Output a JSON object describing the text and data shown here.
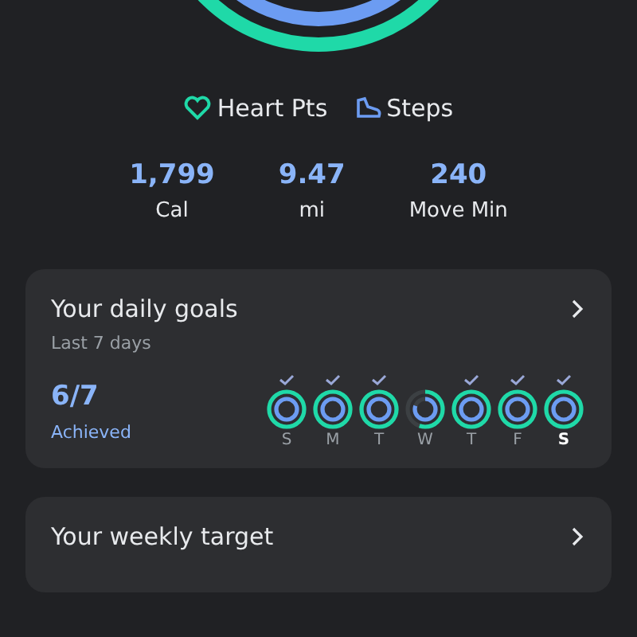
{
  "legend": [
    {
      "kind": "heart",
      "label": "Heart Pts"
    },
    {
      "kind": "steps",
      "label": "Steps"
    }
  ],
  "stats": [
    {
      "value": "1,799",
      "label": "Cal"
    },
    {
      "value": "9.47",
      "label": "mi"
    },
    {
      "value": "240",
      "label": "Move Min"
    }
  ],
  "daily_goals": {
    "title": "Your daily goals",
    "subtitle": "Last 7 days",
    "achieved": "6/7",
    "achieved_label": "Achieved",
    "days": [
      {
        "label": "S",
        "checked": true,
        "rings": [
          {
            "kind": "heart",
            "level": 1
          },
          {
            "kind": "steps",
            "level": 1
          }
        ],
        "today": false
      },
      {
        "label": "M",
        "checked": true,
        "rings": [
          {
            "kind": "heart",
            "level": 1
          },
          {
            "kind": "steps",
            "level": 1
          }
        ],
        "today": false
      },
      {
        "label": "T",
        "checked": true,
        "rings": [
          {
            "kind": "heart",
            "level": 1
          },
          {
            "kind": "steps",
            "level": 1
          }
        ],
        "today": false
      },
      {
        "label": "W",
        "checked": false,
        "rings": [
          {
            "kind": "heart",
            "level": 0.55
          },
          {
            "kind": "steps",
            "level": 0.8
          }
        ],
        "today": false
      },
      {
        "label": "T",
        "checked": true,
        "rings": [
          {
            "kind": "heart",
            "level": 1
          },
          {
            "kind": "steps",
            "level": 1
          }
        ],
        "today": false
      },
      {
        "label": "F",
        "checked": true,
        "rings": [
          {
            "kind": "heart",
            "level": 1
          },
          {
            "kind": "steps",
            "level": 1
          }
        ],
        "today": false
      },
      {
        "label": "S",
        "checked": true,
        "rings": [
          {
            "kind": "heart",
            "level": 1
          },
          {
            "kind": "steps",
            "level": 1
          }
        ],
        "today": true
      }
    ]
  },
  "weekly_target": {
    "title": "Your weekly target"
  }
}
